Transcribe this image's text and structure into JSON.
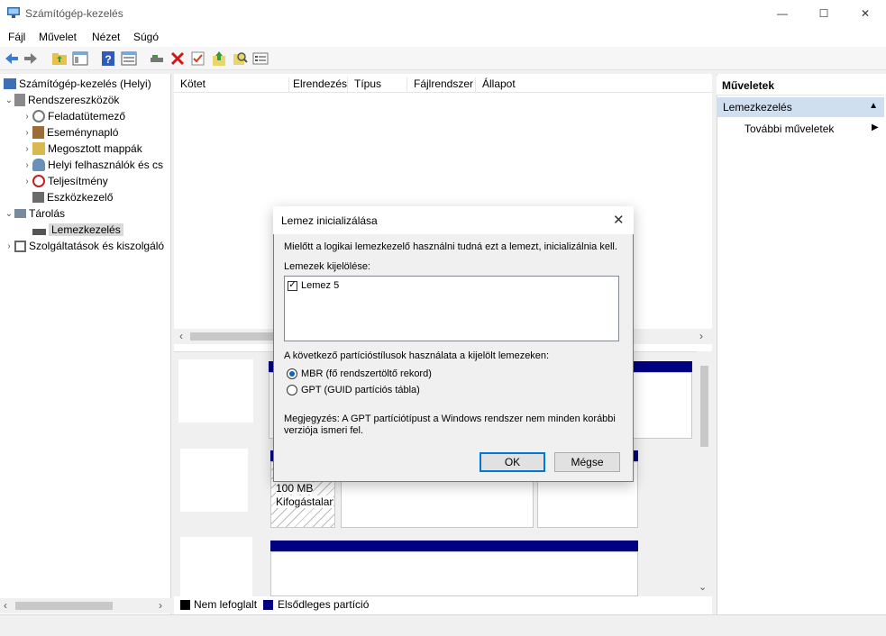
{
  "window": {
    "title": "Számítógép-kezelés",
    "minimize": "—",
    "maximize": "☐",
    "close": "✕"
  },
  "menu": [
    "Fájl",
    "Művelet",
    "Nézet",
    "Súgó"
  ],
  "toolbar_icons": [
    "back-icon",
    "forward-icon",
    "up-folder-icon",
    "show-hide-tree-icon",
    "help-icon",
    "properties-icon",
    "connect-icon",
    "delete-icon",
    "check-icon",
    "import-icon",
    "search-icon",
    "view-icon"
  ],
  "tree": [
    {
      "label": "Számítógép-kezelés (Helyi)",
      "level": 0,
      "expanded": null
    },
    {
      "label": "Rendszereszközök",
      "level": 1,
      "expanded": true
    },
    {
      "label": "Feladatütemező",
      "level": 2,
      "expanded": false
    },
    {
      "label": "Eseménynapló",
      "level": 2,
      "expanded": false
    },
    {
      "label": "Megosztott mappák",
      "level": 2,
      "expanded": false
    },
    {
      "label": "Helyi felhasználók és cs",
      "level": 2,
      "expanded": false
    },
    {
      "label": "Teljesítmény",
      "level": 2,
      "expanded": false
    },
    {
      "label": "Eszközkezelő",
      "level": 2,
      "expanded": null
    },
    {
      "label": "Tárolás",
      "level": 1,
      "expanded": true
    },
    {
      "label": "Lemezkezelés",
      "level": 2,
      "expanded": null,
      "selected": true
    },
    {
      "label": "Szolgáltatások és kiszolgáló",
      "level": 1,
      "expanded": false
    }
  ],
  "columns": [
    "Kötet",
    "Elrendezés",
    "Típus",
    "Fájlrendszer",
    "Állapot"
  ],
  "graph": {
    "partition_size": "100 MB",
    "partition_status": "Kifogástalan"
  },
  "legend": {
    "unallocated": "Nem lefoglalt",
    "primary": "Elsődleges partíció"
  },
  "actions": {
    "header": "Műveletek",
    "section": "Lemezkezelés",
    "more": "További műveletek"
  },
  "dialog": {
    "title": "Lemez inicializálása",
    "intro": "Mielőtt a logikai lemezkezelő használni tudná ezt a lemezt, inicializálnia kell.",
    "select_label": "Lemezek kijelölése:",
    "disk_item": "Lemez 5",
    "disk_checked": true,
    "style_label": "A következő partícióstílusok használata a kijelölt lemezeken:",
    "mbr": "MBR (fő rendszertöltő rekord)",
    "gpt": "GPT (GUID partíciós tábla)",
    "selected_style": "MBR",
    "note_line1": "Megjegyzés: A GPT partíciótípust a Windows rendszer nem minden korábbi",
    "note_line2": "verziója ismeri fel.",
    "ok": "OK",
    "cancel": "Mégse"
  }
}
